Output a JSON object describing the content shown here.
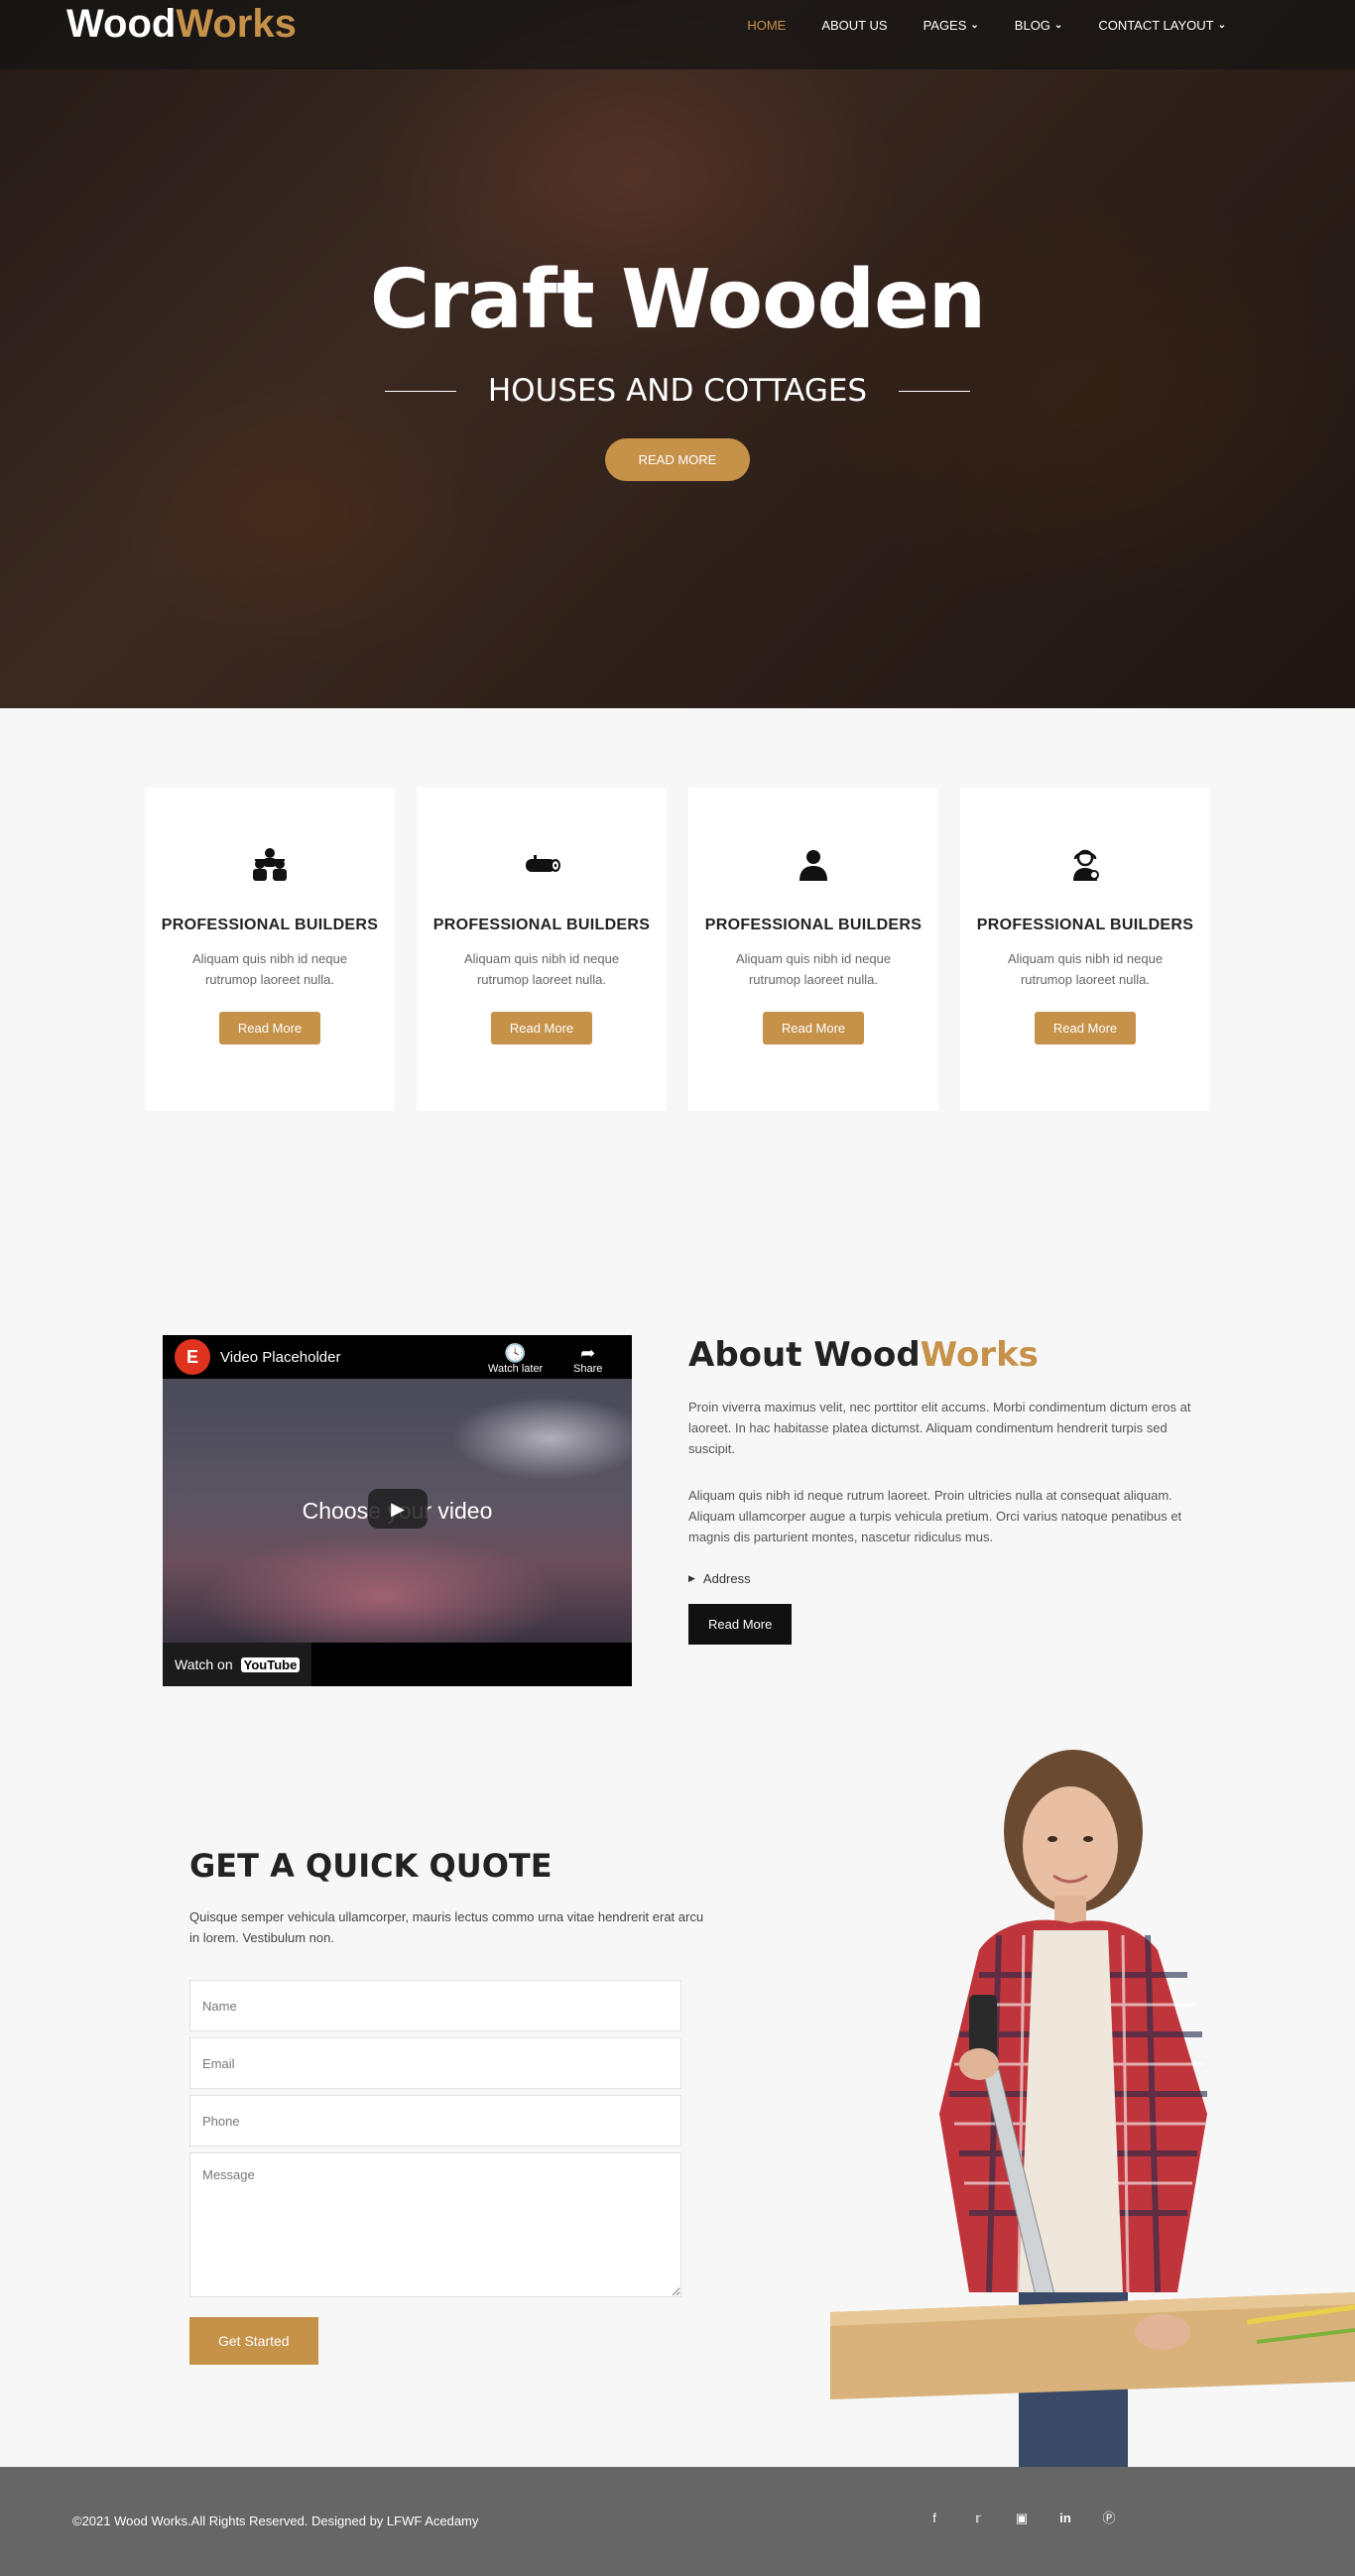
{
  "brand": {
    "part1": "Wood",
    "part2": "Works"
  },
  "nav": [
    {
      "label": "HOME",
      "active": true,
      "dropdown": false
    },
    {
      "label": "ABOUT US",
      "active": false,
      "dropdown": false
    },
    {
      "label": "PAGES",
      "active": false,
      "dropdown": true
    },
    {
      "label": "BLOG",
      "active": false,
      "dropdown": true
    },
    {
      "label": "CONTACT LAYOUT",
      "active": false,
      "dropdown": true
    }
  ],
  "hero": {
    "title": "Craft Wooden",
    "subtitle": "HOUSES AND COTTAGES",
    "button": "READ MORE"
  },
  "features": [
    {
      "icon": "workers-icon",
      "title": "PROFESSIONAL BUILDERS",
      "text": "Aliquam quis nibh id neque rutrumop laoreet nulla.",
      "button": "Read More"
    },
    {
      "icon": "log-icon",
      "title": "PROFESSIONAL BUILDERS",
      "text": "Aliquam quis nibh id neque rutrumop laoreet nulla.",
      "button": "Read More"
    },
    {
      "icon": "person-icon",
      "title": "PROFESSIONAL BUILDERS",
      "text": "Aliquam quis nibh id neque rutrumop laoreet nulla.",
      "button": "Read More"
    },
    {
      "icon": "support-agent-icon",
      "title": "PROFESSIONAL BUILDERS",
      "text": "Aliquam quis nibh id neque rutrumop laoreet nulla.",
      "button": "Read More"
    }
  ],
  "video": {
    "title": "Video Placeholder",
    "watch_later": "Watch later",
    "share": "Share",
    "center_text": "Choose your video",
    "watch_on": "Watch on",
    "youtube": "YouTube"
  },
  "about": {
    "title_part1": "About Wood",
    "title_part2": "Works",
    "para1": "Proin viverra maximus velit, nec porttitor elit accums. Morbi condimentum dictum eros at laoreet. In hac habitasse platea dictumst. Aliquam condimentum hendrerit turpis sed suscipit.",
    "para2": "Aliquam quis nibh id neque rutrum laoreet. Proin ultricies nulla at consequat aliquam. Aliquam ullamcorper augue a turpis vehicula pretium. Orci varius natoque penatibus et magnis dis parturient montes, nascetur ridiculus mus.",
    "address_label": "Address",
    "button": "Read More"
  },
  "quote": {
    "title": "GET A QUICK QUOTE",
    "description": "Quisque semper vehicula ullamcorper, mauris lectus commo urna vitae hendrerit erat arcu in lorem. Vestibulum non.",
    "name_placeholder": "Name",
    "email_placeholder": "Email",
    "phone_placeholder": "Phone",
    "message_placeholder": "Message",
    "button": "Get Started"
  },
  "footer": {
    "copyright": "©2021 Wood Works.All Rights Reserved. Designed by LFWF Acedamy",
    "socials": [
      "facebook-icon",
      "twitter-icon",
      "instagram-icon",
      "linkedin-icon",
      "pinterest-icon"
    ]
  },
  "colors": {
    "accent": "#c69149",
    "dark": "#111111",
    "footer": "#666666"
  }
}
